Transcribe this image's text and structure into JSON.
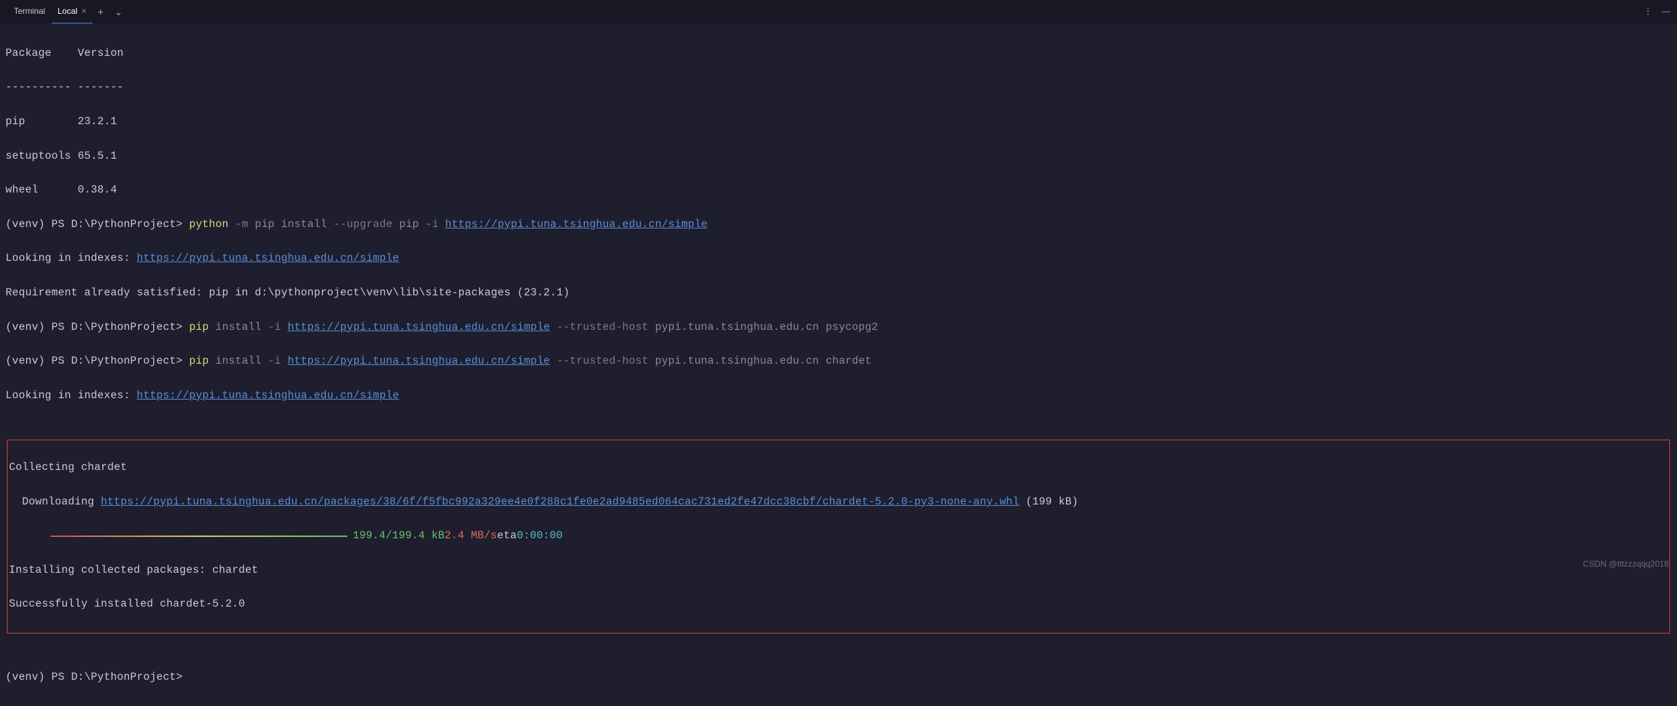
{
  "tabbar": {
    "title": "Terminal",
    "tab_label": "Local",
    "plus": "+",
    "chevron": "⌄",
    "menu_icon": "⋮",
    "dash_icon": "—"
  },
  "header": {
    "col1": "Package",
    "col2": "Version",
    "sep1": "----------",
    "sep2": "-------"
  },
  "packages": [
    {
      "name": "pip",
      "version": "23.2.1"
    },
    {
      "name": "setuptools",
      "version": "65.5.1"
    },
    {
      "name": "wheel",
      "version": "0.38.4"
    }
  ],
  "prompt": "(venv) PS D:\\PythonProject> ",
  "commands": {
    "python": "python",
    "pip": "pip",
    "install": "install",
    "m_flag": "-m",
    "upgrade_flag": "--upgrade",
    "pip_arg": "pip",
    "i_flag": "-i",
    "trusted_flag": "--trusted-host",
    "host": "pypi.tuna.tsinghua.edu.cn",
    "psycopg2": "psycopg2",
    "chardet": "chardet"
  },
  "urls": {
    "simple": "https://pypi.tuna.tsinghua.edu.cn/simple",
    "whl": "https://pypi.tuna.tsinghua.edu.cn/packages/38/6f/f5fbc992a329ee4e0f288c1fe0e2ad9485ed064cac731ed2fe47dcc38cbf/chardet-5.2.0-py3-none-any.whl"
  },
  "output": {
    "looking": "Looking in indexes: ",
    "req_satisfied": "Requirement already satisfied: pip in d:\\pythonproject\\venv\\lib\\site-packages (23.2.1)",
    "collecting": "Collecting chardet",
    "downloading": "  Downloading ",
    "whl_size": " (199 kB)",
    "progress_size": "199.4/199.4 kB",
    "progress_speed": "2.4 MB/s",
    "eta_label": "eta",
    "eta_value": "0:00:00",
    "installing": "Installing collected packages: chardet",
    "success": "Successfully installed chardet-5.2.0"
  },
  "watermark": "CSDN @tttzzzqqq2018"
}
